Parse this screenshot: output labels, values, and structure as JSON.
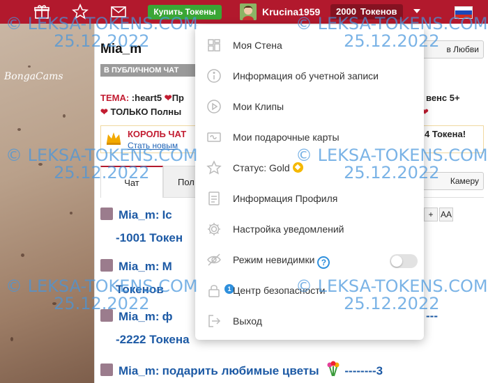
{
  "topbar": {
    "buy_button": "Купить Токены",
    "username": "Krucina1959",
    "token_count": "2000",
    "token_label": "Токенов",
    "icons": [
      "gift-icon",
      "star-icon",
      "mail-icon"
    ],
    "accent_color": "#b2192d",
    "flag": "russia-flag"
  },
  "video": {
    "logo": "BongaCams"
  },
  "room": {
    "title": "Mia_m",
    "love_button": "в Любви",
    "public_chat": "В ПУБЛИЧНОМ ЧАТ",
    "topic_label": "ТЕМА:",
    "topic_text": ":heart5",
    "topic_text_2": "Пр",
    "topic_line2": "ТОЛЬКО Полны",
    "topic_right": "венс 5+",
    "king_title": "КОРОЛЬ ЧАТ",
    "king_link": "Стать новым",
    "king_right": "4 Токена!",
    "tabs": {
      "chat": "Чат",
      "users": "Пол"
    },
    "camera_button": "Камеру",
    "font_plus": "+",
    "font_size": "AA"
  },
  "messages": [
    {
      "user": "Mia_m:",
      "text": "Ic",
      "cont": "-1001 Токен"
    },
    {
      "user": "Mia_m:",
      "text": "M",
      "cont": "Токенов"
    },
    {
      "user": "Mia_m:",
      "text": "ф",
      "cont": "-2222 Токена",
      "tail": "---"
    },
    {
      "user": "Mia_m:",
      "text": "подарить любимые цветы",
      "tail": "--------3"
    }
  ],
  "menu": {
    "items": [
      {
        "label": "Моя Стена",
        "icon": "wall-icon"
      },
      {
        "label": "Информация об учетной записи",
        "icon": "info-icon"
      },
      {
        "label": "Мои Клипы",
        "icon": "play-icon"
      },
      {
        "label": "Мои подарочные карты",
        "icon": "giftcard-icon"
      },
      {
        "label": "Статус:",
        "value": "Gold",
        "icon": "star-icon"
      },
      {
        "label": "Информация Профиля",
        "icon": "document-icon"
      },
      {
        "label": "Настройка уведомлений",
        "icon": "gear-icon"
      },
      {
        "label": "Режим невидимки",
        "icon": "eye-off-icon",
        "help": "?",
        "toggle_on": false
      },
      {
        "label": "Центр безопасности",
        "icon": "lock-icon",
        "badge": "1"
      },
      {
        "label": "Выход",
        "icon": "logout-icon"
      }
    ]
  },
  "watermarks": [
    {
      "line1": "© LEKSA-TOKENS.COM",
      "line2": "25.12.2022"
    },
    {
      "line1": "© LEKSA-TOKENS.COM",
      "line2": "25.12.2022"
    },
    {
      "line1": "© LEKSA-TOKENS.COM",
      "line2": "25.12.2022"
    },
    {
      "line1": "© LEKSA-TOKENS.COM",
      "line2": "25.12.2022"
    },
    {
      "line1": "© LEKSA-TOKENS.COM",
      "line2": "25.12.2022"
    },
    {
      "line1": "© LEKSA-TOKENS.COM",
      "line2": "25.12.2022"
    }
  ]
}
